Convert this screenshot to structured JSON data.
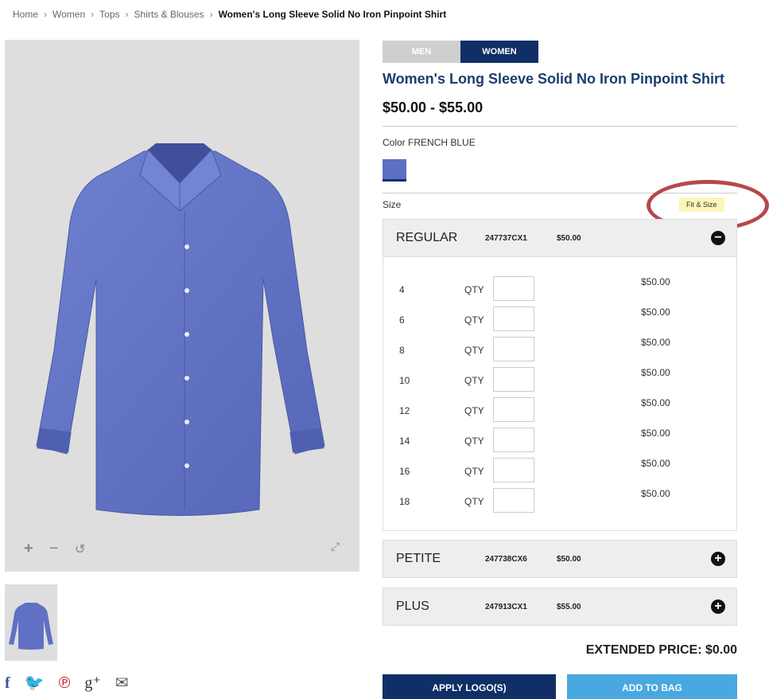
{
  "breadcrumb": {
    "items": [
      "Home",
      "Women",
      "Tops",
      "Shirts & Blouses"
    ],
    "current": "Women's Long Sleeve Solid No Iron Pinpoint Shirt"
  },
  "gender_tabs": [
    "MEN",
    "WOMEN"
  ],
  "product": {
    "title": "Women's Long Sleeve Solid No Iron Pinpoint Shirt",
    "price_range": "$50.00 - $55.00",
    "color_label": "Color",
    "color_value": "FRENCH BLUE",
    "swatch_color": "#5d6fc4"
  },
  "size": {
    "label": "Size",
    "fit_link": "Fit & Size"
  },
  "size_groups": [
    {
      "name": "REGULAR",
      "code": "247737CX1",
      "price": "$50.00",
      "state": "expanded"
    },
    {
      "name": "PETITE",
      "code": "247738CX6",
      "price": "$50.00",
      "state": "collapsed"
    },
    {
      "name": "PLUS",
      "code": "247913CX1",
      "price": "$55.00",
      "state": "collapsed"
    }
  ],
  "regular_sizes": [
    {
      "size": "4",
      "qty_label": "QTY",
      "qty": "",
      "price": "$50.00"
    },
    {
      "size": "6",
      "qty_label": "QTY",
      "qty": "",
      "price": "$50.00"
    },
    {
      "size": "8",
      "qty_label": "QTY",
      "qty": "",
      "price": "$50.00"
    },
    {
      "size": "10",
      "qty_label": "QTY",
      "qty": "",
      "price": "$50.00"
    },
    {
      "size": "12",
      "qty_label": "QTY",
      "qty": "",
      "price": "$50.00"
    },
    {
      "size": "14",
      "qty_label": "QTY",
      "qty": "",
      "price": "$50.00"
    },
    {
      "size": "16",
      "qty_label": "QTY",
      "qty": "",
      "price": "$50.00"
    },
    {
      "size": "18",
      "qty_label": "QTY",
      "qty": "",
      "price": "$50.00"
    }
  ],
  "extended_price": "EXTENDED PRICE: $0.00",
  "buttons": {
    "apply_logo": "APPLY LOGO(S)",
    "add_to_bag": "ADD TO BAG"
  },
  "image_controls": {
    "zoom_in": "+",
    "zoom_out": "−",
    "rotate": "↺",
    "fullscreen": "⤢"
  },
  "social_icons": [
    {
      "name": "facebook-icon",
      "glyph": "f"
    },
    {
      "name": "twitter-icon",
      "glyph": "🐦"
    },
    {
      "name": "pinterest-icon",
      "glyph": "℗"
    },
    {
      "name": "google-plus-icon",
      "glyph": "g⁺"
    },
    {
      "name": "email-icon",
      "glyph": "✉"
    }
  ],
  "colors": {
    "navy": "#0f2f66",
    "sky": "#4aa8e0",
    "annotation_ring": "#b5484b",
    "fit_badge": "#fbf6b8"
  }
}
